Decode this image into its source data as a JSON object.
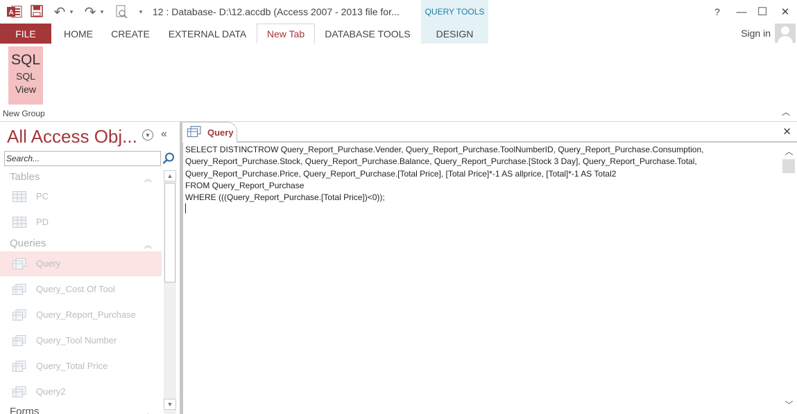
{
  "titlebar": {
    "title": "12 : Database- D:\\12.accdb (Access 2007 - 2013 file for...",
    "contextual_tab": "QUERY TOOLS",
    "help": "?",
    "minimize": "—",
    "restore": "☐",
    "close": "✕",
    "undo_glyph": "↶",
    "redo_glyph": "↷",
    "dropdown_glyph": "▾",
    "customize_glyph": "▾"
  },
  "ribbon_tabs": {
    "file": "FILE",
    "home": "HOME",
    "create": "CREATE",
    "external_data": "EXTERNAL DATA",
    "new_tab": "New Tab",
    "database_tools": "DATABASE TOOLS",
    "design": "DESIGN",
    "sign_in": "Sign in"
  },
  "ribbon": {
    "sql_glyph": "SQL",
    "sql_view_label": "SQL View",
    "group_label": "New Group",
    "collapse_glyph": "︿"
  },
  "nav": {
    "title": "All Access Obj...",
    "collapse_glyph": "«",
    "dropdown_glyph": "▼",
    "search_placeholder": "Search...",
    "sections": {
      "tables": "Tables",
      "queries": "Queries",
      "forms": "Forms"
    },
    "section_chevron": "︽",
    "tables": [
      {
        "label": "PC"
      },
      {
        "label": "PD"
      }
    ],
    "queries": [
      {
        "label": "Query"
      },
      {
        "label": "Query_Cost Of Tool"
      },
      {
        "label": "Query_Report_Purchase"
      },
      {
        "label": "Query_Tool Number"
      },
      {
        "label": "Query_Total Price"
      },
      {
        "label": "Query2"
      }
    ],
    "scroll_up": "▲",
    "scroll_down": "▼"
  },
  "document": {
    "tab_label": "Query",
    "close_glyph": "✕",
    "sql_text": "SELECT DISTINCTROW Query_Report_Purchase.Vender, Query_Report_Purchase.ToolNumberID, Query_Report_Purchase.Consumption,\nQuery_Report_Purchase.Stock, Query_Report_Purchase.Balance, Query_Report_Purchase.[Stock 3 Day], Query_Report_Purchase.Total,\nQuery_Report_Purchase.Price, Query_Report_Purchase.[Total Price], [Total Price]*-1 AS allprice, [Total]*-1 AS Total2\nFROM Query_Report_Purchase\nWHERE (((Query_Report_Purchase.[Total Price])<0));",
    "scroll_up": "︿",
    "scroll_down": "﹀"
  },
  "colors": {
    "accent": "#a4373a",
    "contextual": "#e4f2f5",
    "selected_button": "#f4c0c1"
  }
}
